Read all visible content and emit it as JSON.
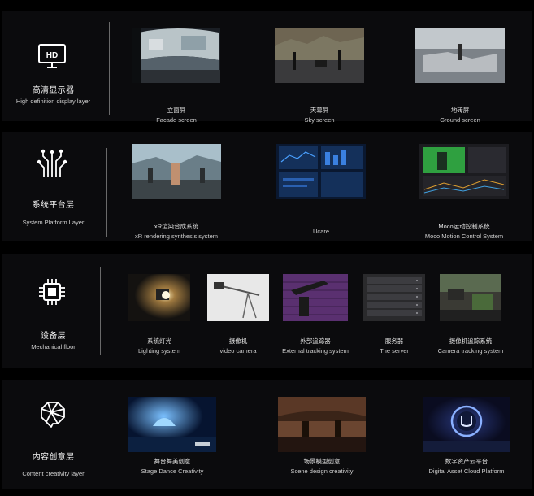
{
  "layers": [
    {
      "cn": "高清显示器",
      "en": "High definition display layer",
      "icon": "hd-monitor-icon",
      "items": [
        {
          "cn": "立面屏",
          "en": "Facade screen"
        },
        {
          "cn": "天幕屏",
          "en": "Sky screen"
        },
        {
          "cn": "地砖屏",
          "en": "Ground screen"
        }
      ]
    },
    {
      "cn": "系统平台层",
      "en": "System Platform Layer",
      "icon": "circuit-network-icon",
      "items": [
        {
          "cn": "xR渲染合成系统",
          "en": "xR rendering synthesis system"
        },
        {
          "cn": "",
          "en": "Ucare"
        },
        {
          "cn": "Moco运动控制系统",
          "en": "Moco Motion Control System"
        }
      ]
    },
    {
      "cn": "设备层",
      "en": "Mechanical floor",
      "icon": "cpu-chip-icon",
      "items": [
        {
          "cn": "系统灯光",
          "en": "Lighting system"
        },
        {
          "cn": "摄像机",
          "en": "video camera"
        },
        {
          "cn": "外部追踪器",
          "en": "External tracking system"
        },
        {
          "cn": "服务器",
          "en": "The server"
        },
        {
          "cn": "摄像机追踪系统",
          "en": "Camera tracking system"
        }
      ]
    },
    {
      "cn": "内容创意层",
      "en": "Content creativity layer",
      "icon": "geometric-brain-icon",
      "items": [
        {
          "cn": "舞台舞美创意",
          "en": "Stage Dance Creativity"
        },
        {
          "cn": "场景模型创意",
          "en": "Scene design creativity"
        },
        {
          "cn": "数字资产云平台",
          "en": "Digital Asset Cloud Platform"
        }
      ]
    }
  ],
  "icon_text": {
    "hd": "HD"
  }
}
